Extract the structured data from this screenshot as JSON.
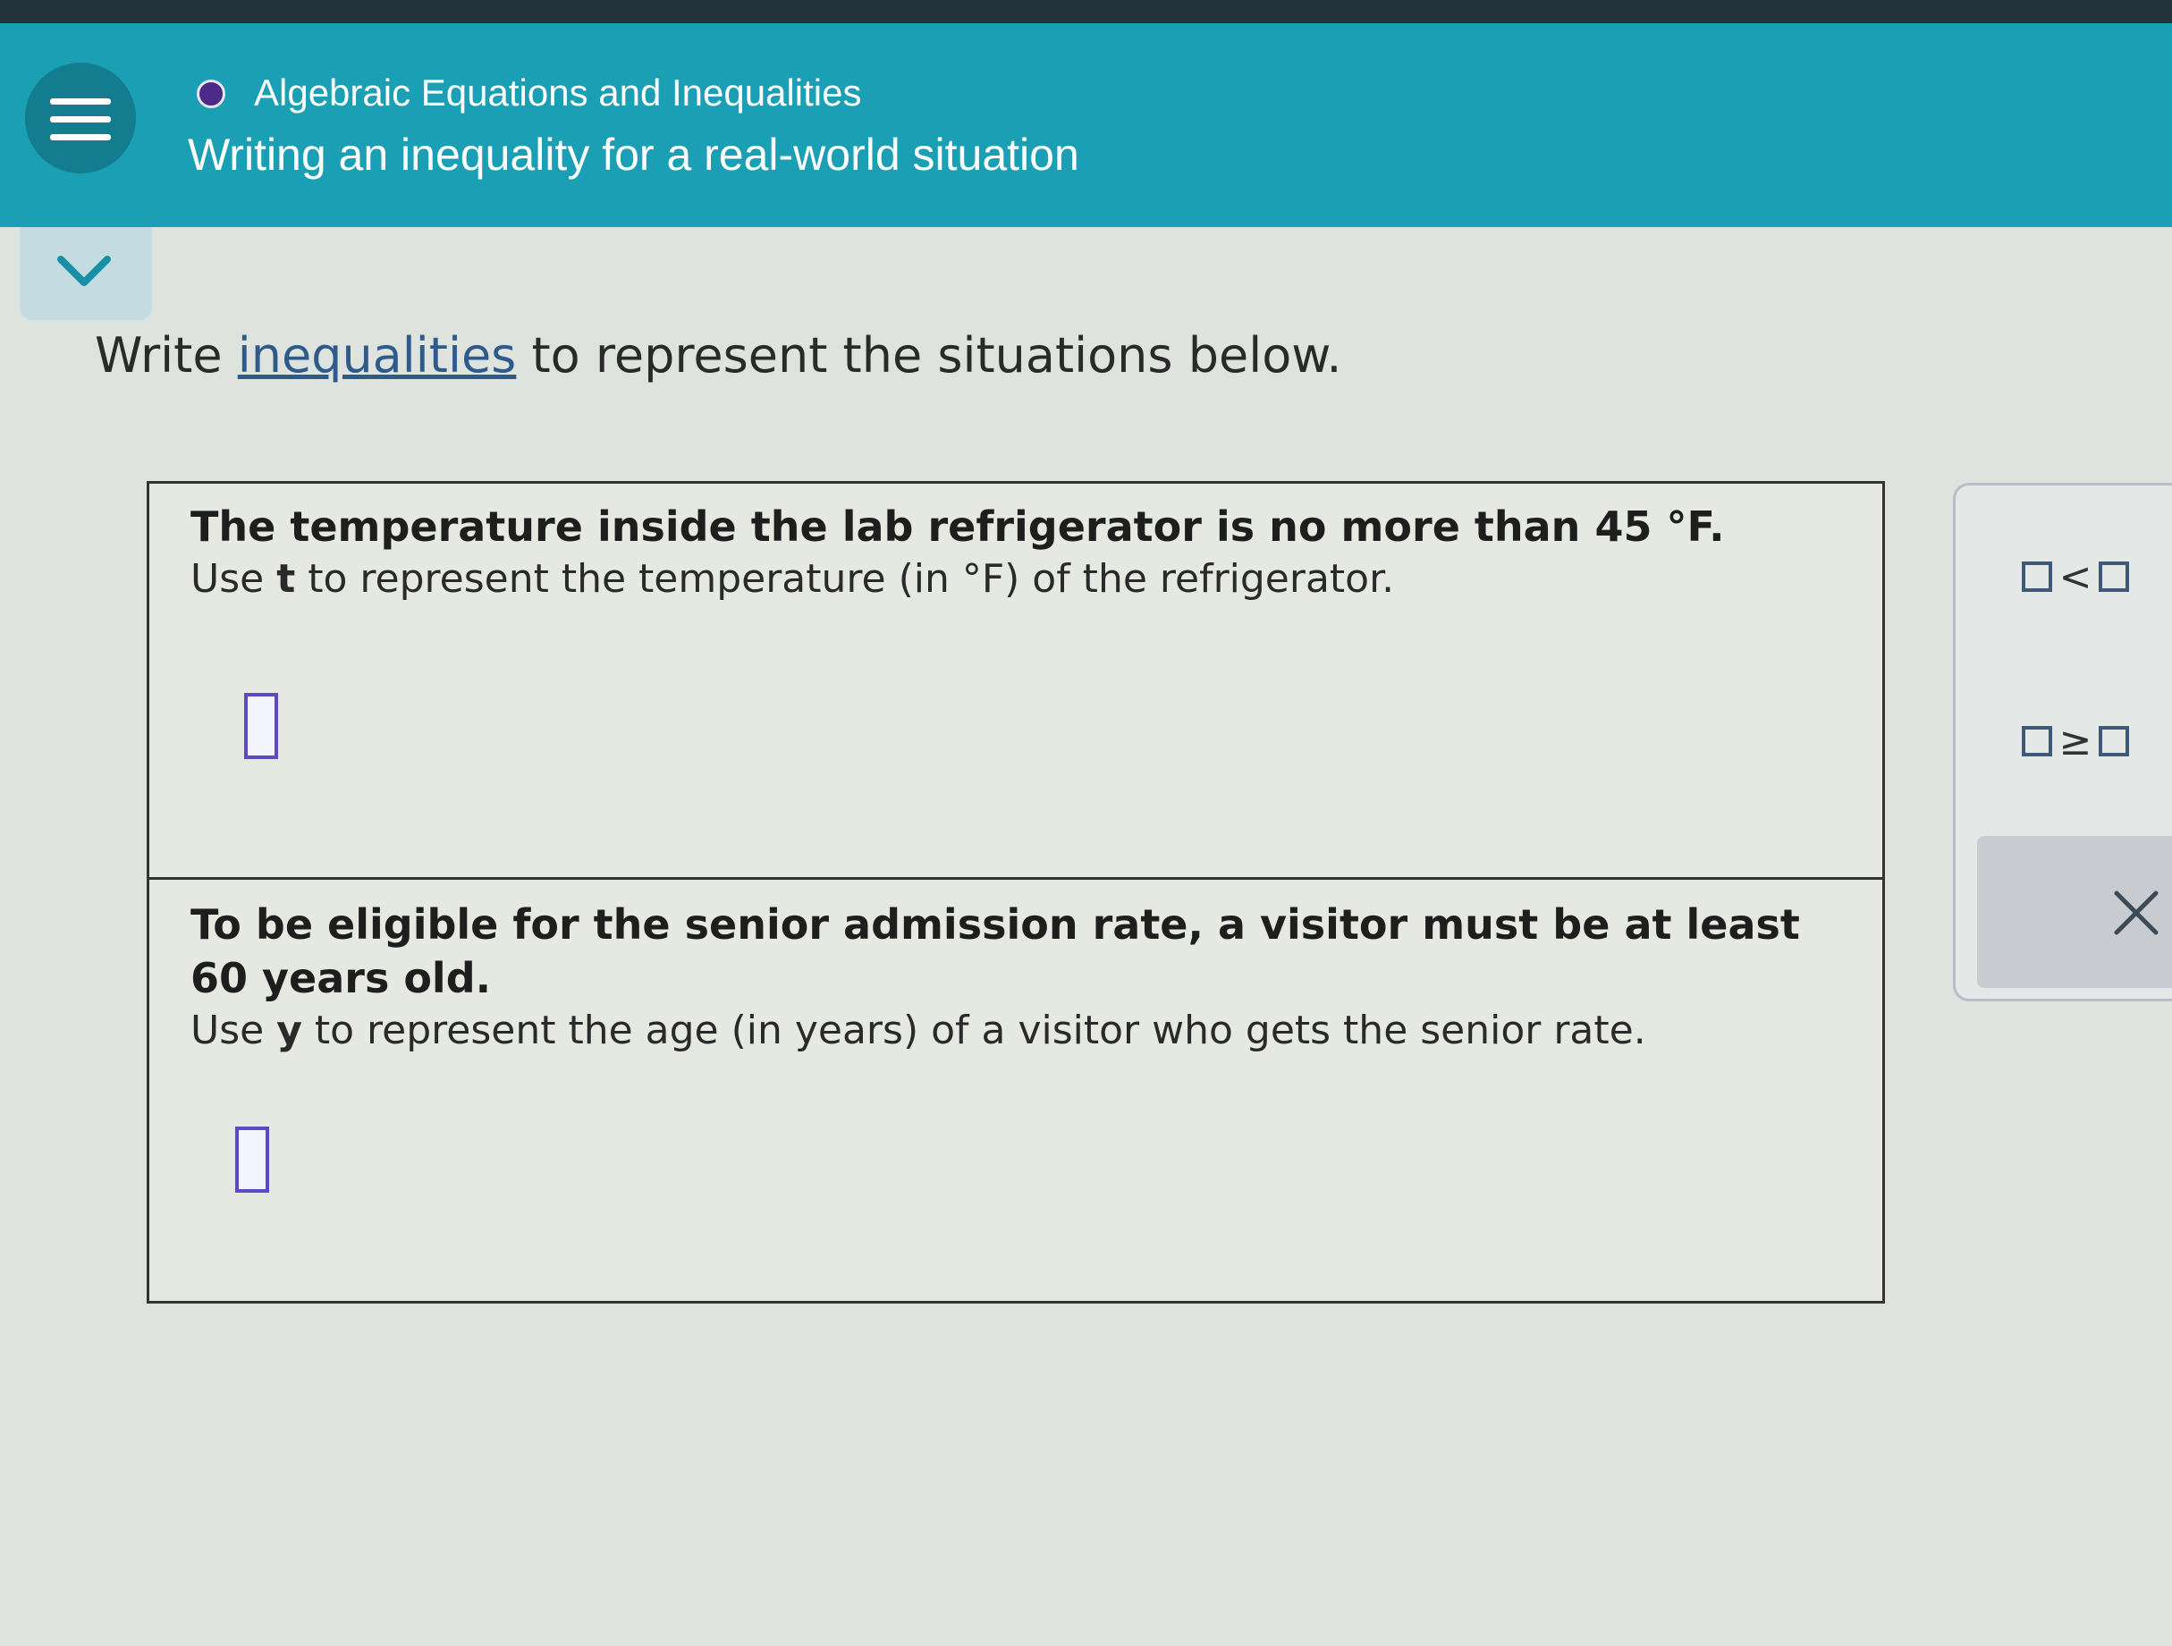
{
  "header": {
    "topic": "Algebraic Equations and Inequalities",
    "lesson": "Writing an inequality for a real-world situation"
  },
  "instructions": {
    "before": "Write ",
    "link": "inequalities",
    "after": " to represent the situations below."
  },
  "questions": [
    {
      "statement": "The temperature inside the lab refrigerator is no more than 45 °F.",
      "use_prefix": "Use ",
      "variable": "t",
      "use_suffix": " to represent the temperature (in °F) of the refrigerator.",
      "answer_value": ""
    },
    {
      "statement": "To be eligible for the senior admission rate, a visitor must be at least 60 years old.",
      "use_prefix": "Use ",
      "variable": "y",
      "use_suffix": " to represent the age (in years) of a visitor who gets the senior rate.",
      "answer_value": ""
    }
  ],
  "palette": {
    "less_than_symbol": "<",
    "greater_equal_symbol": "≥",
    "clear_icon": "close-icon"
  },
  "colors": {
    "header": "#1a9fb4",
    "topic_dot": "#4b2a8a",
    "answer_box": "#5d49c4"
  }
}
